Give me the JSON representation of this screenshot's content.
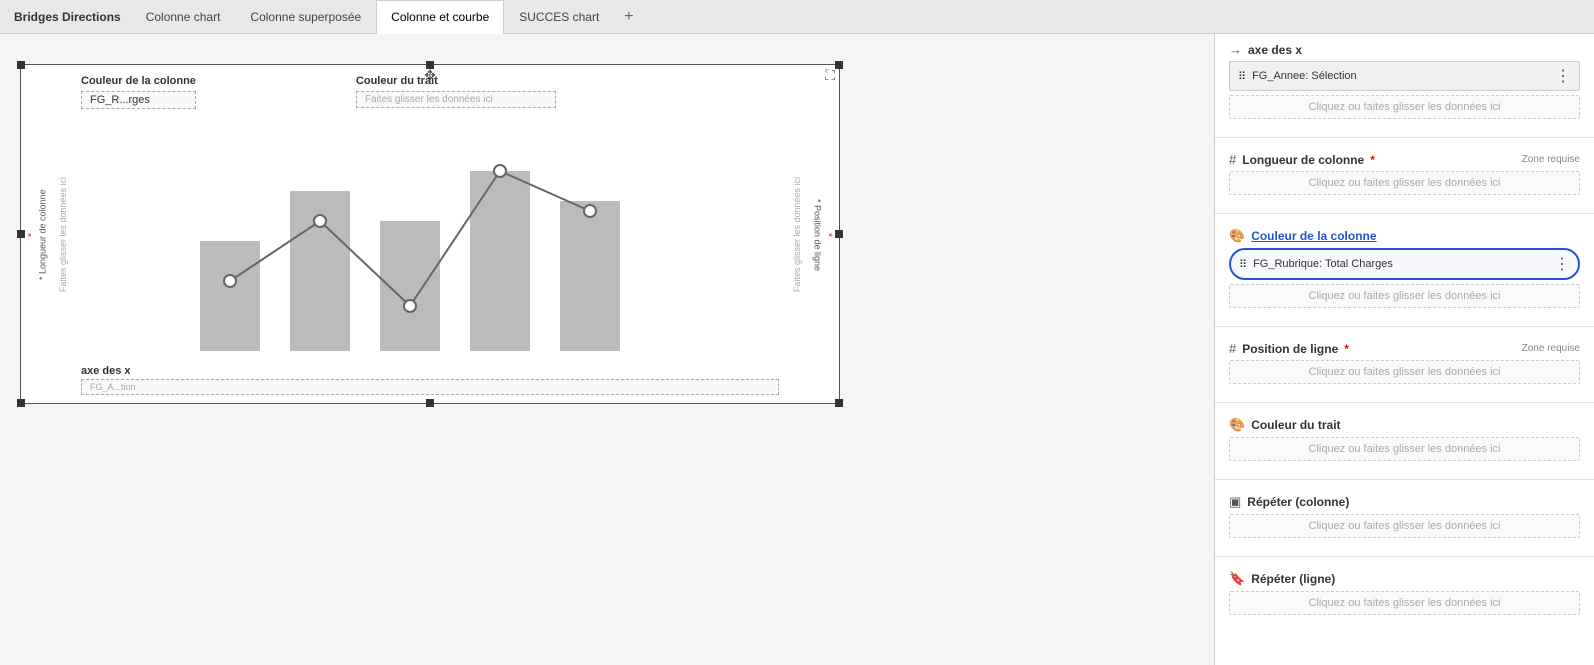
{
  "app": {
    "title": "Bridges Directions"
  },
  "tabs": [
    {
      "id": "bridges",
      "label": "Bridges Directions",
      "active": false
    },
    {
      "id": "colonne-chart",
      "label": "Colonne chart",
      "active": false
    },
    {
      "id": "colonne-superposee",
      "label": "Colonne superposée",
      "active": false
    },
    {
      "id": "colonne-et-courbe",
      "label": "Colonne et courbe",
      "active": true
    },
    {
      "id": "succes-chart",
      "label": "SUCCES chart",
      "active": false
    }
  ],
  "tab_add": "+",
  "chart": {
    "couleur_colonne_label": "Couleur de la colonne",
    "couleur_colonne_tag": "FG_R...rges",
    "couleur_trait_label": "Couleur du trait",
    "couleur_trait_placeholder": "Faites glisser les données ici",
    "longueur_colonne_label": "* Longueur de colonne",
    "longueur_drag_text": "Faites glisser les données ici",
    "axe_x_label": "axe des x",
    "axe_x_tag": "FG_A...tion",
    "position_ligne_label": "* Position de ligne",
    "position_drag_text": "Faites glisser les données ici"
  },
  "right_panel": {
    "axe_des_x_title": "axe des x",
    "axe_x_chip": "FG_Annee: Sélection",
    "axe_x_drop": "Cliquez ou faites glisser les données ici",
    "longueur_colonne_title": "Longueur de colonne",
    "longueur_required": "Zone requise",
    "longueur_drop": "Cliquez ou faites glisser les données ici",
    "couleur_colonne_title": "Couleur de la colonne",
    "couleur_colonne_chip": "FG_Rubrique: Total Charges",
    "couleur_colonne_drop": "Cliquez ou faites glisser les données ici",
    "position_ligne_title": "Position de ligne",
    "position_required": "Zone requise",
    "position_drop": "Cliquez ou faites glisser les données ici",
    "couleur_trait_title": "Couleur du trait",
    "couleur_trait_drop": "Cliquez ou faites glisser les données ici",
    "repeter_colonne_title": "Répéter (colonne)",
    "repeter_colonne_drop": "Cliquez ou faites glisser les données ici",
    "repeter_ligne_title": "Répéter (ligne)",
    "repeter_ligne_drop": "Cliquez ou faites glisser les données ici"
  },
  "icons": {
    "arrow_right": "→",
    "hash": "#",
    "palette_col": "🎨",
    "palette_line": "🎨",
    "repeat_col": "▣",
    "repeat_line": "🔖",
    "drag": "⠿",
    "move": "✥",
    "expand": "⛶",
    "dots": "⋮"
  }
}
